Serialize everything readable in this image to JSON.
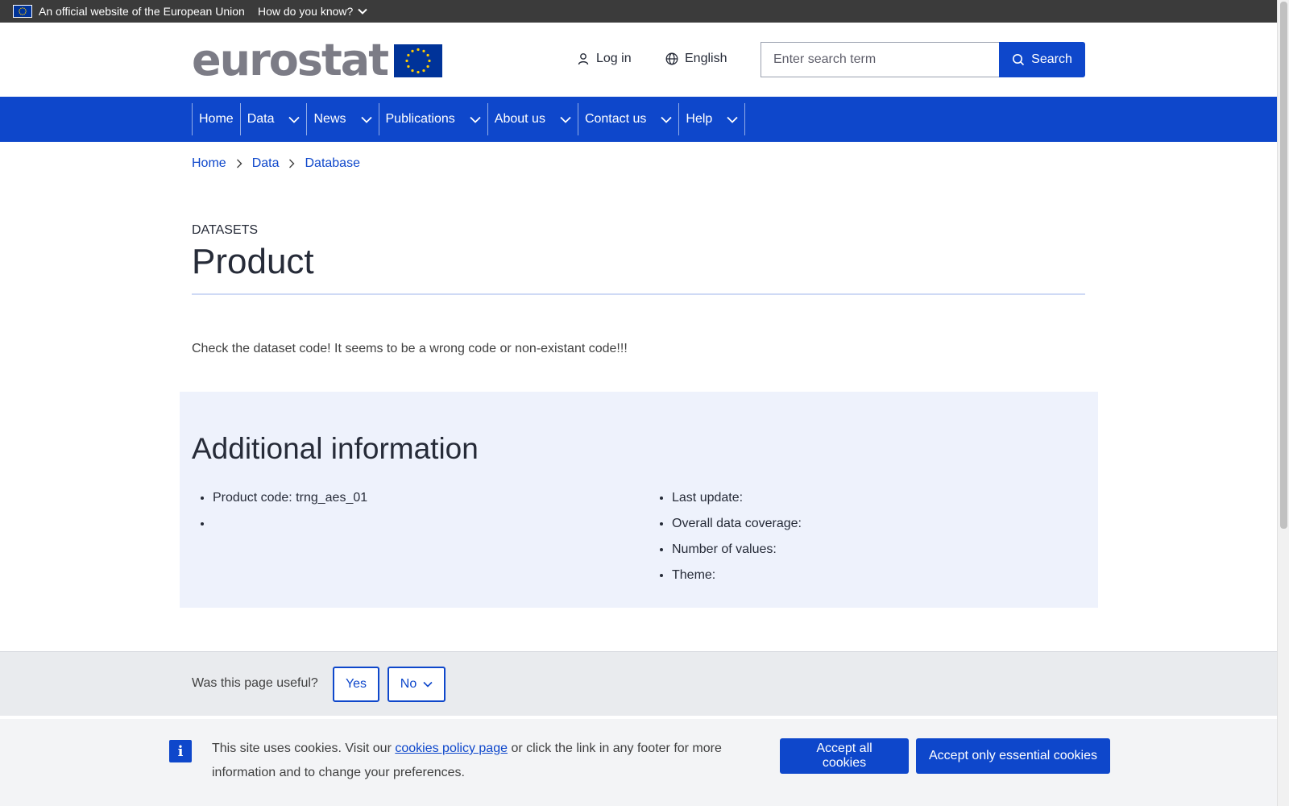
{
  "eu_bar": {
    "official_text": "An official website of the European Union",
    "how_text": "How do you know?"
  },
  "header": {
    "logo_text": "eurostat",
    "login_label": "Log in",
    "language_label": "English",
    "search_placeholder": "Enter search term",
    "search_button": "Search"
  },
  "nav": {
    "items": [
      {
        "label": "Home"
      },
      {
        "label": "Data"
      },
      {
        "label": "News"
      },
      {
        "label": "Publications"
      },
      {
        "label": "About us"
      },
      {
        "label": "Contact us"
      },
      {
        "label": "Help"
      }
    ]
  },
  "breadcrumb": [
    "Home",
    "Data",
    "Database"
  ],
  "page": {
    "label": "DATASETS",
    "title": "Product",
    "message": "Check the dataset code! It seems to be a wrong code or non-existant code!!!"
  },
  "additional_info": {
    "heading": "Additional information",
    "left_items": [
      "Product code: trng_aes_01",
      ""
    ],
    "right_items": [
      "Last update:",
      "Overall data coverage:",
      "Number of values:",
      "Theme:"
    ]
  },
  "feedback": {
    "question": "Was this page useful?",
    "yes_label": "Yes",
    "no_label": "No"
  },
  "cookie": {
    "text_before": "This site uses cookies. Visit our ",
    "link_text": "cookies policy page",
    "text_after": " or click the link in any footer for more information and to change your preferences.",
    "accept_all": "Accept all cookies",
    "accept_essential": "Accept only essential cookies"
  },
  "colors": {
    "primary": "#0e47cb",
    "eu_bar": "#3b3b3b",
    "info_bg": "#eef2fc",
    "logo_grey": "#7c7c86"
  }
}
